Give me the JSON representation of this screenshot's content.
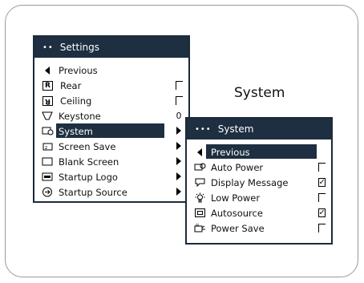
{
  "caption": "System",
  "settings_menu": {
    "title": "Settings",
    "items": [
      {
        "icon": "back-arrow-icon",
        "label": "Previous"
      },
      {
        "icon": "rear-icon",
        "label": "Rear",
        "control": "checkbox",
        "checked": false
      },
      {
        "icon": "ceiling-icon",
        "label": "Ceiling",
        "control": "checkbox",
        "checked": false
      },
      {
        "icon": "keystone-icon",
        "label": "Keystone",
        "control": "value",
        "value": "0"
      },
      {
        "icon": "system-icon",
        "label": "System",
        "control": "submenu",
        "selected": true
      },
      {
        "icon": "screen-save-icon",
        "label": "Screen Save",
        "control": "submenu"
      },
      {
        "icon": "blank-screen-icon",
        "label": "Blank Screen",
        "control": "submenu"
      },
      {
        "icon": "startup-logo-icon",
        "label": "Startup Logo",
        "control": "submenu"
      },
      {
        "icon": "startup-source-icon",
        "label": "Startup Source",
        "control": "submenu"
      }
    ]
  },
  "system_menu": {
    "title": "System",
    "items": [
      {
        "icon": "back-arrow-icon",
        "label": "Previous",
        "selected": true
      },
      {
        "icon": "auto-power-icon",
        "label": "Auto Power",
        "control": "checkbox",
        "checked": false
      },
      {
        "icon": "display-message-icon",
        "label": "Display Message",
        "control": "checkbox",
        "checked": true
      },
      {
        "icon": "low-power-icon",
        "label": "Low Power",
        "control": "checkbox",
        "checked": false
      },
      {
        "icon": "autosource-icon",
        "label": "Autosource",
        "control": "checkbox",
        "checked": true
      },
      {
        "icon": "power-save-icon",
        "label": "Power Save",
        "control": "checkbox",
        "checked": false
      }
    ]
  },
  "colors": {
    "header": "#1d2f40",
    "highlight": "#1d2f40",
    "text": "#111111"
  }
}
